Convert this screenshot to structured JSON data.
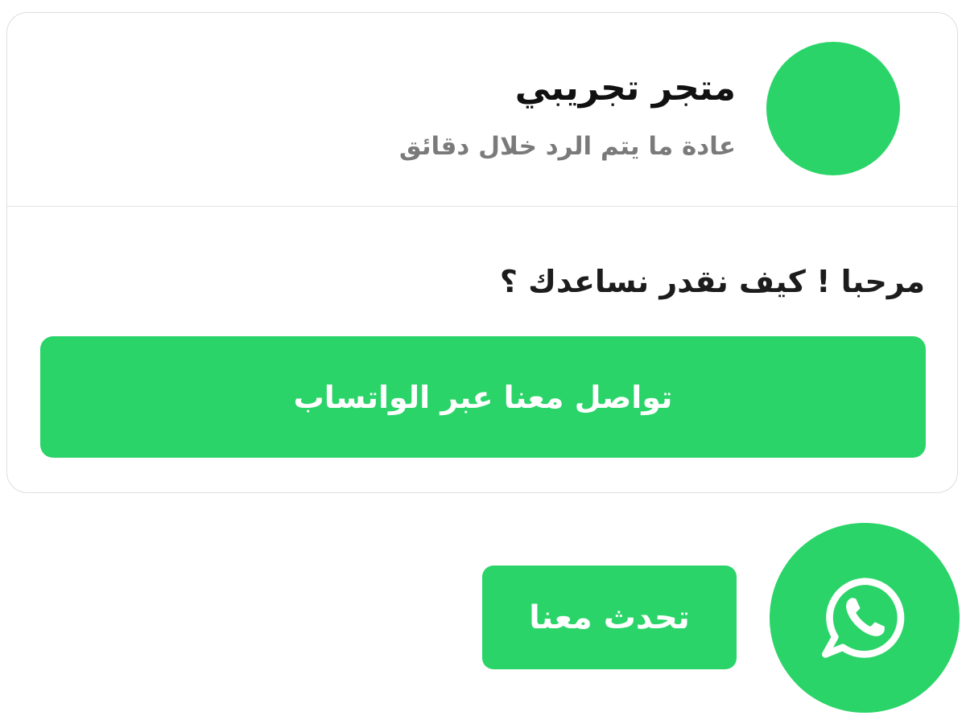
{
  "widget": {
    "store_name": "متجر تجريبي",
    "reply_note": "عادة ما يتم الرد خلال دقائق",
    "greeting": "مرحبا ! كيف نقدر نساعدك ؟",
    "cta_label": "تواصل معنا عبر الواتساب",
    "avatar_color": "#2ad468"
  },
  "launcher": {
    "chat_label": "تحدث معنا",
    "icon": "whatsapp-icon",
    "color": "#2ad468"
  }
}
